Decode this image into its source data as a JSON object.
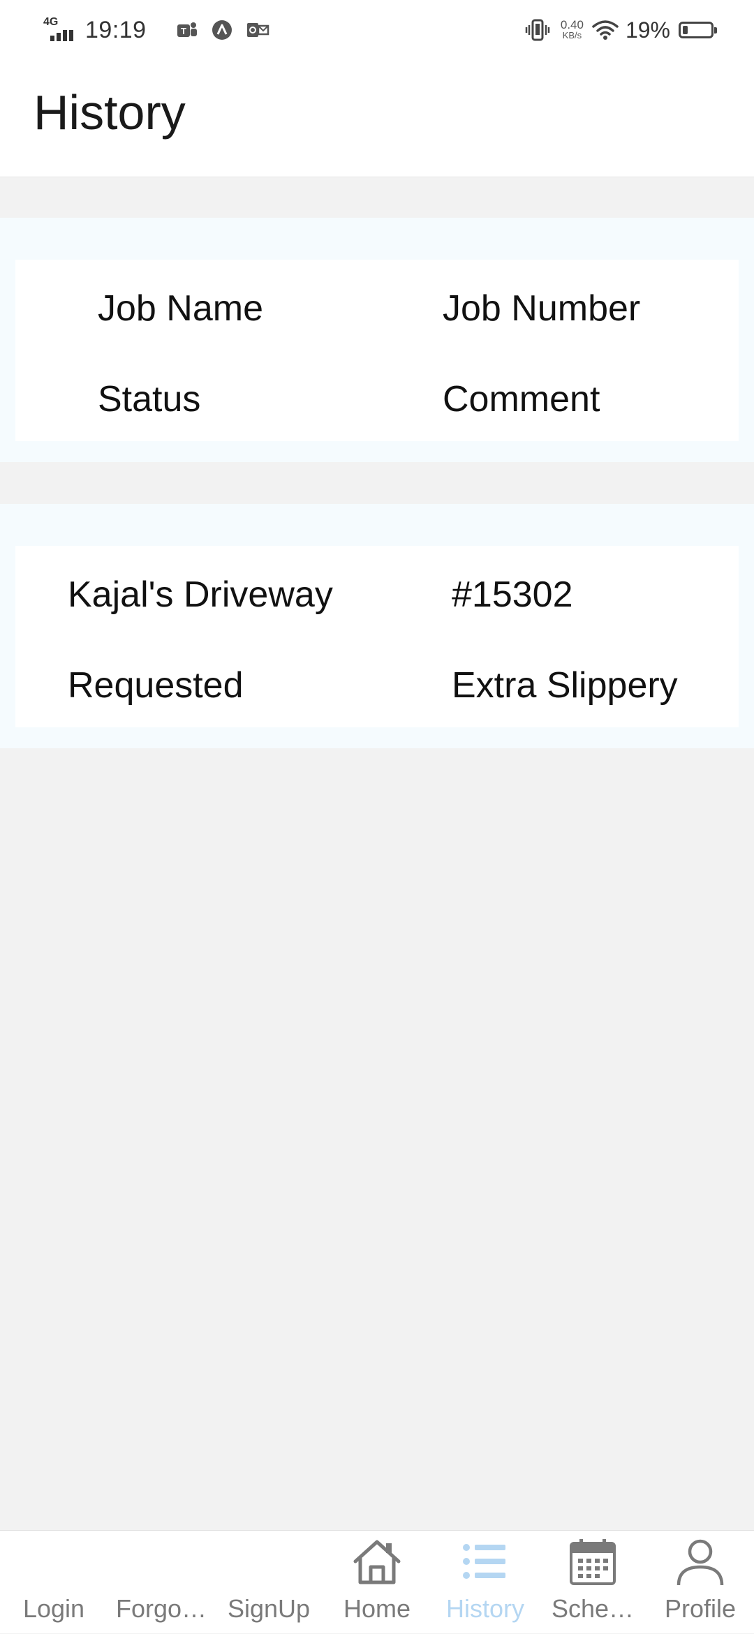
{
  "status_bar": {
    "network_type": "4G",
    "time": "19:19",
    "speed_value": "0.40",
    "speed_unit": "KB/s",
    "battery_percent": "19%",
    "battery_level": 0.19
  },
  "header": {
    "title": "History"
  },
  "table": {
    "headers": {
      "job_name": "Job Name",
      "job_number": "Job Number",
      "status": "Status",
      "comment": "Comment"
    },
    "rows": [
      {
        "job_name": "Kajal's Driveway",
        "job_number": "#15302",
        "status": "Requested",
        "comment": "Extra Slippery"
      }
    ]
  },
  "bottom_nav": {
    "items": [
      {
        "label": "Login",
        "icon": "none"
      },
      {
        "label": "Forgo…",
        "icon": "none"
      },
      {
        "label": "SignUp",
        "icon": "none"
      },
      {
        "label": "Home",
        "icon": "home-icon"
      },
      {
        "label": "History",
        "icon": "list-icon",
        "active": true
      },
      {
        "label": "Sche…",
        "icon": "calendar-icon"
      },
      {
        "label": "Profile",
        "icon": "person-icon"
      }
    ]
  },
  "colors": {
    "active_tab": "#b4d6f2",
    "inactive_tab": "#7a7a7a",
    "card_outer": "#f5fbfe",
    "page_background": "#f2f2f2"
  }
}
